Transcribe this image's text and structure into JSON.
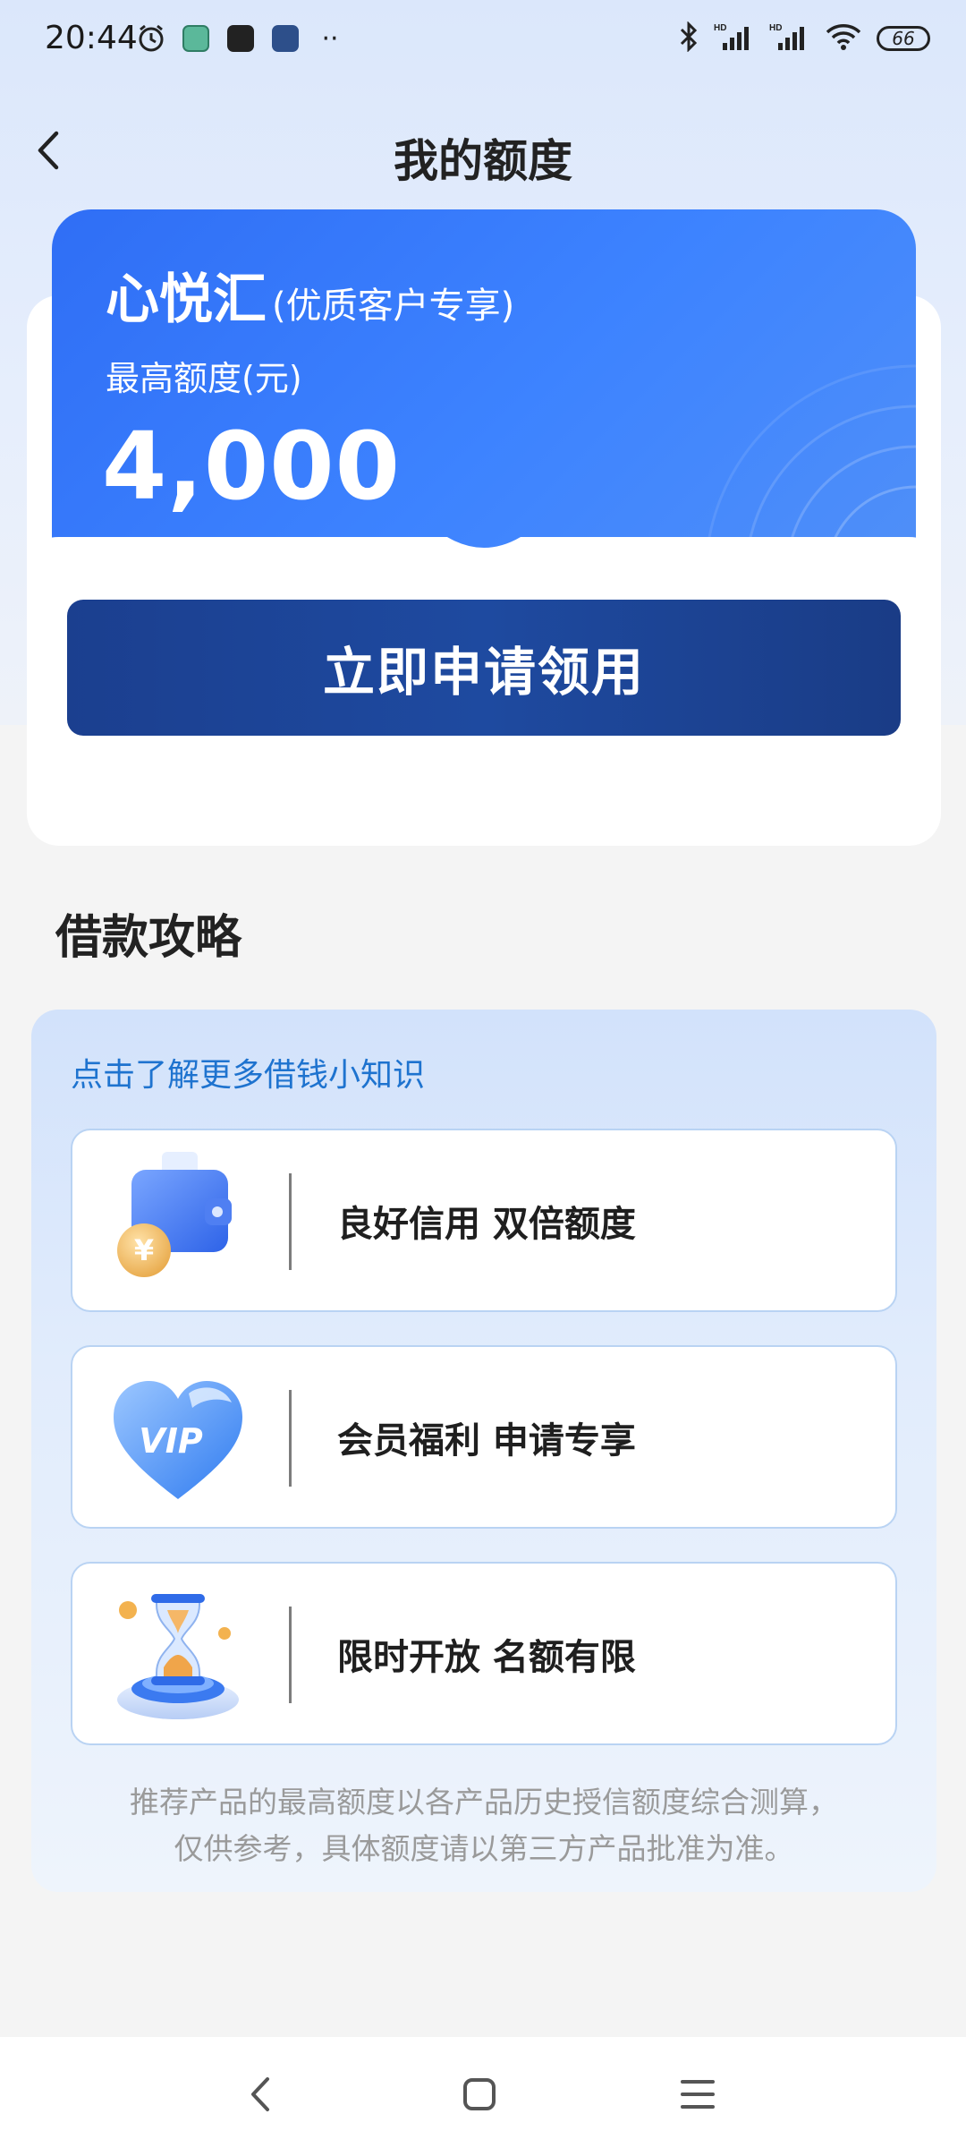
{
  "status_bar": {
    "time": "20:44",
    "icons_left": [
      "alarm-icon",
      "app-icon-green",
      "app-icon-dark",
      "app-icon-blue",
      "more-dots-icon"
    ],
    "icons_right": [
      "bluetooth-icon",
      "signal-hd-icon",
      "signal-hd-icon",
      "wifi-icon"
    ],
    "battery": "66"
  },
  "header": {
    "title": "我的额度",
    "back_icon": "chevron-left-icon"
  },
  "quota_card": {
    "brand": "心悦汇",
    "brand_note": "(优质客户专享)",
    "label": "最高额度(元)",
    "amount": "4,000",
    "apply_button": "立即申请领用"
  },
  "strategy": {
    "title": "借款攻略",
    "link_text": "点击了解更多借钱小知识",
    "tips": [
      {
        "icon": "wallet-coin-icon",
        "text": "良好信用 双倍额度"
      },
      {
        "icon": "vip-heart-icon",
        "text": "会员福利 申请专享"
      },
      {
        "icon": "hourglass-icon",
        "text": "限时开放 名额有限"
      }
    ],
    "disclaimer_line1": "推荐产品的最高额度以各产品历史授信额度综合测算，",
    "disclaimer_line2": "仅供参考，具体额度请以第三方产品批准为准。"
  },
  "colors": {
    "brand_blue": "#3d83ff",
    "button_navy": "#1e4aa0",
    "link_blue": "#1e73cf"
  },
  "bottom_nav": {
    "icons": [
      "back-nav-icon",
      "home-nav-icon",
      "menu-nav-icon"
    ]
  }
}
